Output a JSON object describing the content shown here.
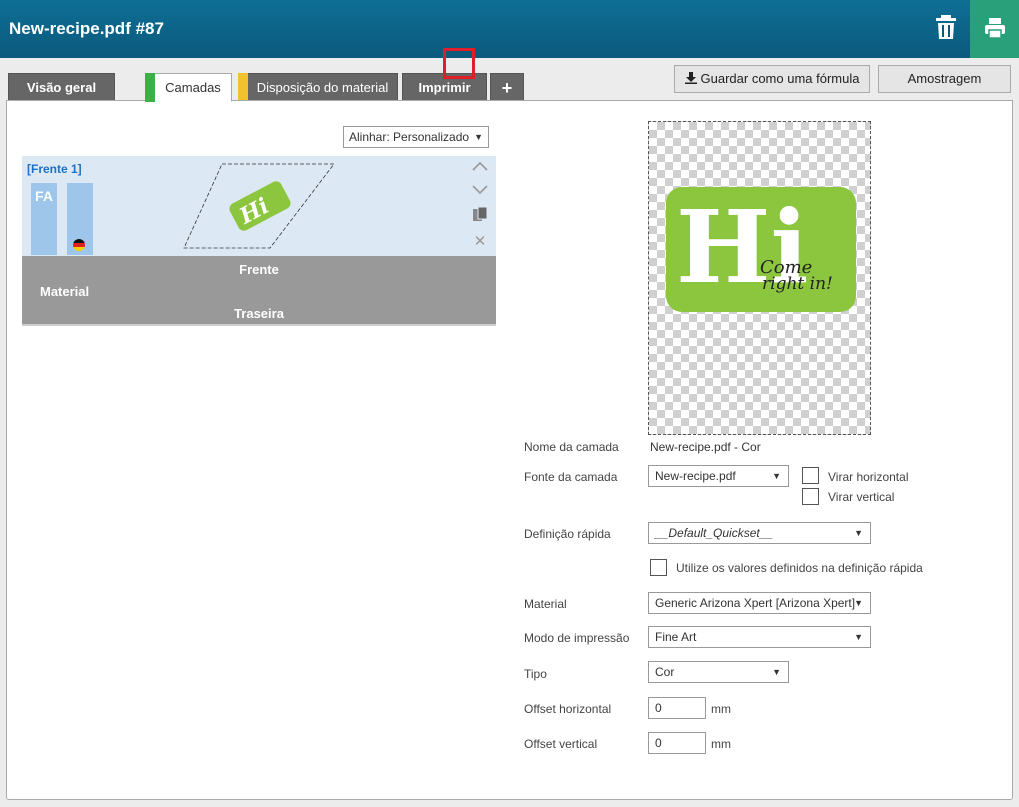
{
  "window": {
    "title": "New-recipe.pdf #87"
  },
  "colors": {
    "header": "#0b5a7c",
    "print_button": "#2aa07a",
    "tab_camadas_bar": "#3cb043",
    "tab_disposicao_bar": "#f2c12e",
    "highlight": "#e01e2a",
    "logo_green": "#8cc63f"
  },
  "header": {
    "trash_icon": "trash-icon",
    "print_icon": "printer-icon"
  },
  "tabs": [
    {
      "label": "Visão geral"
    },
    {
      "label": "Camadas"
    },
    {
      "label": "Disposição do material"
    },
    {
      "label": "Imprimir"
    },
    {
      "label": "+"
    }
  ],
  "actions": {
    "save_recipe": "Guardar como uma fórmula",
    "sampling": "Amostragem"
  },
  "align": {
    "value": "Alinhar: Personalizado"
  },
  "layer": {
    "name": "[Frente 1]",
    "channel": "FA",
    "thumbnail_text": "Hi"
  },
  "material_bar": {
    "front": "Frente",
    "material": "Material",
    "back": "Traseira"
  },
  "preview": {
    "big_text": "Hi",
    "script_text_1": "Come",
    "script_text_2": "right in!"
  },
  "form": {
    "layer_name_label": "Nome da camada",
    "layer_name_value": "New-recipe.pdf - Cor",
    "layer_source_label": "Fonte da camada",
    "layer_source_value": "New-recipe.pdf",
    "flip_h": "Virar horizontal",
    "flip_v": "Virar vertical",
    "quickset_label": "Definição rápida",
    "quickset_value": "__Default_Quickset__",
    "use_quickset": "Utilize os valores definidos na definição rápida",
    "material_label": "Material",
    "material_value": "Generic Arizona Xpert [Arizona Xpert]",
    "print_mode_label": "Modo de impressão",
    "print_mode_value": "Fine Art",
    "type_label": "Tipo",
    "type_value": "Cor",
    "offset_h_label": "Offset horizontal",
    "offset_h_value": "0",
    "offset_v_label": "Offset vertical",
    "offset_v_value": "0",
    "unit": "mm"
  }
}
